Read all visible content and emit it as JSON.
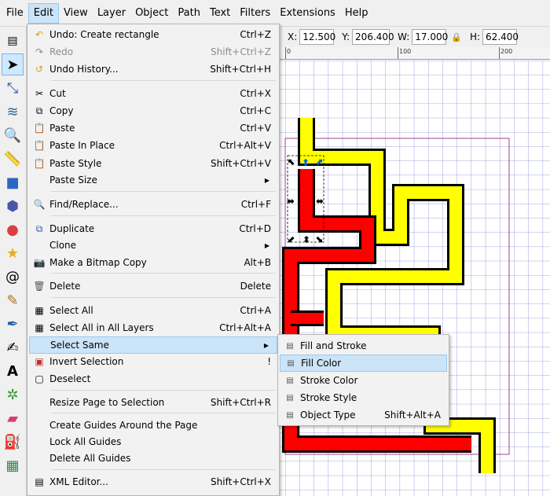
{
  "menubar": [
    "File",
    "Edit",
    "View",
    "Layer",
    "Object",
    "Path",
    "Text",
    "Filters",
    "Extensions",
    "Help"
  ],
  "toolbar": {
    "x_label": "X:",
    "x_value": "12.500",
    "y_label": "Y:",
    "y_value": "206.400",
    "w_label": "W:",
    "w_value": "17.000",
    "h_label": "H:",
    "h_value": "62.400"
  },
  "ruler": {
    "ticks": [
      "0",
      "100",
      "200"
    ]
  },
  "edit_menu": {
    "items": [
      {
        "label": "Undo: Create rectangle",
        "shortcut": "Ctrl+Z",
        "icon": "undo-icon",
        "disabled": false
      },
      {
        "label": "Redo",
        "shortcut": "Shift+Ctrl+Z",
        "icon": "redo-icon",
        "disabled": true
      },
      {
        "label": "Undo History...",
        "shortcut": "Shift+Ctrl+H",
        "icon": "undo-history-icon",
        "disabled": false
      },
      {
        "label": "Cut",
        "shortcut": "Ctrl+X",
        "icon": "scissors-icon",
        "disabled": false
      },
      {
        "label": "Copy",
        "shortcut": "Ctrl+C",
        "icon": "copy-icon",
        "disabled": false
      },
      {
        "label": "Paste",
        "shortcut": "Ctrl+V",
        "icon": "paste-icon",
        "disabled": false
      },
      {
        "label": "Paste In Place",
        "shortcut": "Ctrl+Alt+V",
        "icon": "paste-in-place-icon",
        "disabled": false
      },
      {
        "label": "Paste Style",
        "shortcut": "Shift+Ctrl+V",
        "icon": "paste-style-icon",
        "disabled": false
      },
      {
        "label": "Paste Size",
        "shortcut": "",
        "icon": "",
        "disabled": false
      },
      {
        "label": "Find/Replace...",
        "shortcut": "Ctrl+F",
        "icon": "find-icon",
        "disabled": false
      },
      {
        "label": "Duplicate",
        "shortcut": "Ctrl+D",
        "icon": "duplicate-icon",
        "disabled": false
      },
      {
        "label": "Clone",
        "shortcut": "",
        "icon": "",
        "disabled": false
      },
      {
        "label": "Make a Bitmap Copy",
        "shortcut": "Alt+B",
        "icon": "camera-icon",
        "disabled": false
      },
      {
        "label": "Delete",
        "shortcut": "Delete",
        "icon": "trash-icon",
        "disabled": false
      },
      {
        "label": "Select All",
        "shortcut": "Ctrl+A",
        "icon": "select-all-icon",
        "disabled": false
      },
      {
        "label": "Select All in All Layers",
        "shortcut": "Ctrl+Alt+A",
        "icon": "select-all-layers-icon",
        "disabled": false
      },
      {
        "label": "Select Same",
        "shortcut": "",
        "icon": "",
        "disabled": false
      },
      {
        "label": "Invert Selection",
        "shortcut": "!",
        "icon": "invert-selection-icon",
        "disabled": false
      },
      {
        "label": "Deselect",
        "shortcut": "",
        "icon": "deselect-icon",
        "disabled": false
      },
      {
        "label": "Resize Page to Selection",
        "shortcut": "Shift+Ctrl+R",
        "icon": "",
        "disabled": false
      },
      {
        "label": "Create Guides Around the Page",
        "shortcut": "",
        "icon": "",
        "disabled": false
      },
      {
        "label": "Lock All Guides",
        "shortcut": "",
        "icon": "",
        "disabled": false
      },
      {
        "label": "Delete All Guides",
        "shortcut": "",
        "icon": "",
        "disabled": false
      },
      {
        "label": "XML Editor...",
        "shortcut": "Shift+Ctrl+X",
        "icon": "xml-editor-icon",
        "disabled": false
      }
    ]
  },
  "select_same_submenu": {
    "items": [
      {
        "label": "Fill and Stroke",
        "shortcut": ""
      },
      {
        "label": "Fill Color",
        "shortcut": ""
      },
      {
        "label": "Stroke Color",
        "shortcut": ""
      },
      {
        "label": "Stroke Style",
        "shortcut": ""
      },
      {
        "label": "Object Type",
        "shortcut": "Shift+Alt+A"
      }
    ]
  },
  "colors": {
    "menu_highlight": "#cce4f7",
    "shape_yellow": "#ffff00",
    "shape_red": "#ff0000",
    "grid_line": "#8a8ad8",
    "page_border": "#a0408f"
  }
}
